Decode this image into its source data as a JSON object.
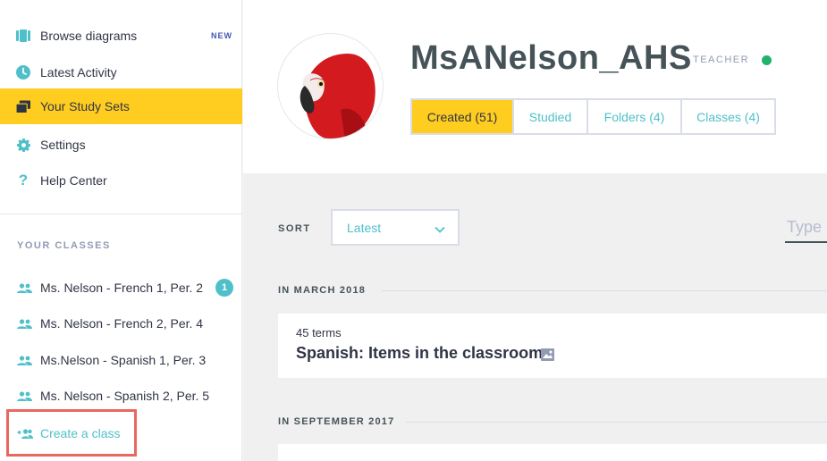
{
  "sidebar": {
    "nav": [
      {
        "label": "Browse diagrams",
        "icon": "diagram-icon",
        "badge": "NEW"
      },
      {
        "label": "Latest Activity",
        "icon": "clock-icon"
      },
      {
        "label": "Your Study Sets",
        "icon": "study-sets-icon",
        "active": true
      },
      {
        "label": "Settings",
        "icon": "gear-icon"
      },
      {
        "label": "Help Center",
        "icon": "question-icon"
      }
    ],
    "classes_title": "YOUR CLASSES",
    "classes": [
      {
        "label": "Ms. Nelson - French 1, Per. 2",
        "badge": "1"
      },
      {
        "label": "Ms. Nelson - French 2, Per. 4"
      },
      {
        "label": "Ms.Nelson - Spanish 1, Per. 3"
      },
      {
        "label": "Ms. Nelson - Spanish 2, Per. 5"
      }
    ],
    "create_class": "Create a class"
  },
  "profile": {
    "username": "MsANelson_AHS",
    "role": "TEACHER",
    "status_color": "#23b26d",
    "tabs": [
      {
        "label": "Created (51)",
        "active": true
      },
      {
        "label": "Studied"
      },
      {
        "label": "Folders (4)"
      },
      {
        "label": "Classes (4)"
      }
    ]
  },
  "content": {
    "sort_label": "SORT",
    "sort_value": "Latest",
    "filter_placeholder": "Type",
    "groups": [
      {
        "label": "IN MARCH 2018",
        "sets": [
          {
            "terms": "45 terms",
            "title": "Spanish: Items in the classroom"
          }
        ]
      },
      {
        "label": "IN SEPTEMBER 2017",
        "sets": []
      }
    ]
  },
  "colors": {
    "accent_yellow": "#ffcd1f",
    "teal": "#4fc0c9",
    "highlight_red": "#e8685f"
  }
}
